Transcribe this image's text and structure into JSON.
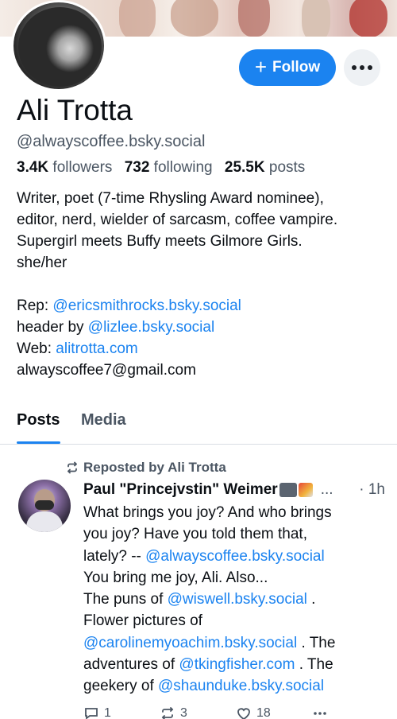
{
  "profile": {
    "name": "Ali Trotta",
    "handle": "@alwayscoffee.bsky.social",
    "followers_count": "3.4K",
    "followers_label": "followers",
    "following_count": "732",
    "following_label": "following",
    "posts_count": "25.5K",
    "posts_label": "posts",
    "follow_label": "Follow",
    "bio": {
      "line1": "Writer, poet (7-time Rhysling Award nominee),",
      "line2": "editor, nerd, wielder of sarcasm, coffee vampire.",
      "line3": "Supergirl meets Buffy meets Gilmore Girls.",
      "line4": "she/her",
      "rep_label": "Rep: ",
      "rep_link": "@ericsmithrocks.bsky.social",
      "header_label": "header by ",
      "header_link": "@lizlee.bsky.social",
      "web_label": "Web: ",
      "web_link": "alitrotta.com",
      "email": "alwayscoffee7@gmail.com"
    }
  },
  "tabs": [
    {
      "label": "Posts"
    },
    {
      "label": "Media"
    }
  ],
  "feed": {
    "repost_label": "Reposted by Ali Trotta",
    "post": {
      "author": "Paul \"Princejvstin\" Weimer",
      "ellipsis": "...",
      "time": "· 1h",
      "lines": [
        {
          "text": "What brings you joy? And who brings"
        },
        {
          "text": "you joy? Have you told them that,"
        },
        {
          "pre": "lately? -- ",
          "link": "@alwayscoffee.bsky.social"
        },
        {
          "text": "You bring me joy, Ali. Also..."
        },
        {
          "pre": "The puns of ",
          "link": "@wiswell.bsky.social",
          "post": " ."
        },
        {
          "text": "Flower pictures of"
        },
        {
          "link": "@carolinemyoachim.bsky.social",
          "post": " . The"
        },
        {
          "pre": "adventures of ",
          "link": "@tkingfisher.com",
          "post": " . The"
        },
        {
          "pre": "geekery of ",
          "link": "@shaunduke.bsky.social"
        }
      ],
      "reply_count": "1",
      "repost_count": "3",
      "like_count": "18"
    }
  },
  "colors": {
    "accent": "#1b83f0",
    "muted_text": "#4b5663"
  }
}
